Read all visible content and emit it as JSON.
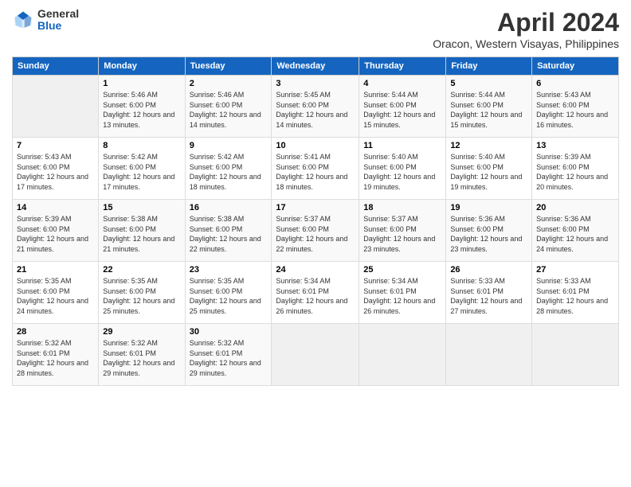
{
  "logo": {
    "general": "General",
    "blue": "Blue"
  },
  "title": "April 2024",
  "subtitle": "Oracon, Western Visayas, Philippines",
  "headers": [
    "Sunday",
    "Monday",
    "Tuesday",
    "Wednesday",
    "Thursday",
    "Friday",
    "Saturday"
  ],
  "weeks": [
    [
      {
        "num": "",
        "sunrise": "",
        "sunset": "",
        "daylight": ""
      },
      {
        "num": "1",
        "sunrise": "Sunrise: 5:46 AM",
        "sunset": "Sunset: 6:00 PM",
        "daylight": "Daylight: 12 hours and 13 minutes."
      },
      {
        "num": "2",
        "sunrise": "Sunrise: 5:46 AM",
        "sunset": "Sunset: 6:00 PM",
        "daylight": "Daylight: 12 hours and 14 minutes."
      },
      {
        "num": "3",
        "sunrise": "Sunrise: 5:45 AM",
        "sunset": "Sunset: 6:00 PM",
        "daylight": "Daylight: 12 hours and 14 minutes."
      },
      {
        "num": "4",
        "sunrise": "Sunrise: 5:44 AM",
        "sunset": "Sunset: 6:00 PM",
        "daylight": "Daylight: 12 hours and 15 minutes."
      },
      {
        "num": "5",
        "sunrise": "Sunrise: 5:44 AM",
        "sunset": "Sunset: 6:00 PM",
        "daylight": "Daylight: 12 hours and 15 minutes."
      },
      {
        "num": "6",
        "sunrise": "Sunrise: 5:43 AM",
        "sunset": "Sunset: 6:00 PM",
        "daylight": "Daylight: 12 hours and 16 minutes."
      }
    ],
    [
      {
        "num": "7",
        "sunrise": "Sunrise: 5:43 AM",
        "sunset": "Sunset: 6:00 PM",
        "daylight": "Daylight: 12 hours and 17 minutes."
      },
      {
        "num": "8",
        "sunrise": "Sunrise: 5:42 AM",
        "sunset": "Sunset: 6:00 PM",
        "daylight": "Daylight: 12 hours and 17 minutes."
      },
      {
        "num": "9",
        "sunrise": "Sunrise: 5:42 AM",
        "sunset": "Sunset: 6:00 PM",
        "daylight": "Daylight: 12 hours and 18 minutes."
      },
      {
        "num": "10",
        "sunrise": "Sunrise: 5:41 AM",
        "sunset": "Sunset: 6:00 PM",
        "daylight": "Daylight: 12 hours and 18 minutes."
      },
      {
        "num": "11",
        "sunrise": "Sunrise: 5:40 AM",
        "sunset": "Sunset: 6:00 PM",
        "daylight": "Daylight: 12 hours and 19 minutes."
      },
      {
        "num": "12",
        "sunrise": "Sunrise: 5:40 AM",
        "sunset": "Sunset: 6:00 PM",
        "daylight": "Daylight: 12 hours and 19 minutes."
      },
      {
        "num": "13",
        "sunrise": "Sunrise: 5:39 AM",
        "sunset": "Sunset: 6:00 PM",
        "daylight": "Daylight: 12 hours and 20 minutes."
      }
    ],
    [
      {
        "num": "14",
        "sunrise": "Sunrise: 5:39 AM",
        "sunset": "Sunset: 6:00 PM",
        "daylight": "Daylight: 12 hours and 21 minutes."
      },
      {
        "num": "15",
        "sunrise": "Sunrise: 5:38 AM",
        "sunset": "Sunset: 6:00 PM",
        "daylight": "Daylight: 12 hours and 21 minutes."
      },
      {
        "num": "16",
        "sunrise": "Sunrise: 5:38 AM",
        "sunset": "Sunset: 6:00 PM",
        "daylight": "Daylight: 12 hours and 22 minutes."
      },
      {
        "num": "17",
        "sunrise": "Sunrise: 5:37 AM",
        "sunset": "Sunset: 6:00 PM",
        "daylight": "Daylight: 12 hours and 22 minutes."
      },
      {
        "num": "18",
        "sunrise": "Sunrise: 5:37 AM",
        "sunset": "Sunset: 6:00 PM",
        "daylight": "Daylight: 12 hours and 23 minutes."
      },
      {
        "num": "19",
        "sunrise": "Sunrise: 5:36 AM",
        "sunset": "Sunset: 6:00 PM",
        "daylight": "Daylight: 12 hours and 23 minutes."
      },
      {
        "num": "20",
        "sunrise": "Sunrise: 5:36 AM",
        "sunset": "Sunset: 6:00 PM",
        "daylight": "Daylight: 12 hours and 24 minutes."
      }
    ],
    [
      {
        "num": "21",
        "sunrise": "Sunrise: 5:35 AM",
        "sunset": "Sunset: 6:00 PM",
        "daylight": "Daylight: 12 hours and 24 minutes."
      },
      {
        "num": "22",
        "sunrise": "Sunrise: 5:35 AM",
        "sunset": "Sunset: 6:00 PM",
        "daylight": "Daylight: 12 hours and 25 minutes."
      },
      {
        "num": "23",
        "sunrise": "Sunrise: 5:35 AM",
        "sunset": "Sunset: 6:00 PM",
        "daylight": "Daylight: 12 hours and 25 minutes."
      },
      {
        "num": "24",
        "sunrise": "Sunrise: 5:34 AM",
        "sunset": "Sunset: 6:01 PM",
        "daylight": "Daylight: 12 hours and 26 minutes."
      },
      {
        "num": "25",
        "sunrise": "Sunrise: 5:34 AM",
        "sunset": "Sunset: 6:01 PM",
        "daylight": "Daylight: 12 hours and 26 minutes."
      },
      {
        "num": "26",
        "sunrise": "Sunrise: 5:33 AM",
        "sunset": "Sunset: 6:01 PM",
        "daylight": "Daylight: 12 hours and 27 minutes."
      },
      {
        "num": "27",
        "sunrise": "Sunrise: 5:33 AM",
        "sunset": "Sunset: 6:01 PM",
        "daylight": "Daylight: 12 hours and 28 minutes."
      }
    ],
    [
      {
        "num": "28",
        "sunrise": "Sunrise: 5:32 AM",
        "sunset": "Sunset: 6:01 PM",
        "daylight": "Daylight: 12 hours and 28 minutes."
      },
      {
        "num": "29",
        "sunrise": "Sunrise: 5:32 AM",
        "sunset": "Sunset: 6:01 PM",
        "daylight": "Daylight: 12 hours and 29 minutes."
      },
      {
        "num": "30",
        "sunrise": "Sunrise: 5:32 AM",
        "sunset": "Sunset: 6:01 PM",
        "daylight": "Daylight: 12 hours and 29 minutes."
      },
      {
        "num": "",
        "sunrise": "",
        "sunset": "",
        "daylight": ""
      },
      {
        "num": "",
        "sunrise": "",
        "sunset": "",
        "daylight": ""
      },
      {
        "num": "",
        "sunrise": "",
        "sunset": "",
        "daylight": ""
      },
      {
        "num": "",
        "sunrise": "",
        "sunset": "",
        "daylight": ""
      }
    ]
  ]
}
